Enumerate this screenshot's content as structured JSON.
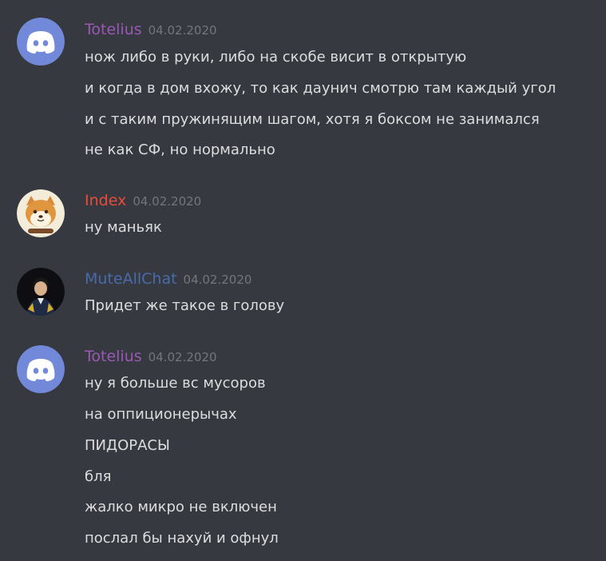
{
  "colors": {
    "background": "#36393f",
    "text": "#dcddde",
    "timestamp": "#72767d",
    "totelius": "#9b59b6",
    "index": "#e74c3c",
    "muteallchat": "#4a6bab",
    "discord_blurple": "#7289da"
  },
  "messages": [
    {
      "author": "Totelius",
      "avatar_icon": "discord-default-avatar-icon",
      "timestamp": "04.02.2020",
      "lines": [
        "нож либо в руки, либо на скобе висит в открытую",
        "и когда в дом вхожу, то как даунич смотрю там каждый угол",
        "и с таким пружинящим шагом, хотя я боксом не занимался",
        "не как СФ, но нормально"
      ]
    },
    {
      "author": "Index",
      "avatar_icon": "shiba-avatar-icon",
      "timestamp": "04.02.2020",
      "lines": [
        "ну маньяк"
      ]
    },
    {
      "author": "MuteAllChat",
      "avatar_icon": "person-avatar-icon",
      "timestamp": "04.02.2020",
      "lines": [
        "Придет же такое в голову"
      ]
    },
    {
      "author": "Totelius",
      "avatar_icon": "discord-default-avatar-icon",
      "timestamp": "04.02.2020",
      "lines": [
        "ну я больше вс мусоров",
        "на оппиционерычах",
        "ПИДОРАСЫ",
        "бля",
        "жалко микро не включен",
        "послал бы нахуй и офнул"
      ]
    }
  ]
}
